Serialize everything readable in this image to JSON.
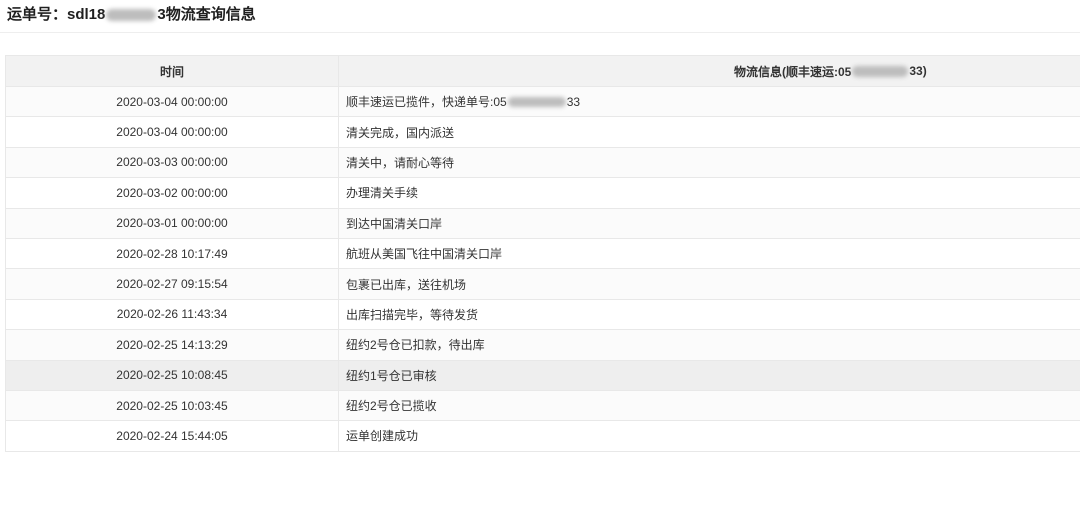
{
  "header": {
    "title_prefix": "运单号：sdl18",
    "title_suffix": "3物流查询信息"
  },
  "table": {
    "columns": {
      "time": "时间",
      "info_prefix": "物流信息(顺丰速运:05",
      "info_suffix": "33)"
    },
    "rows": [
      {
        "time": "2020-03-04 00:00:00",
        "info": "顺丰速运已揽件，快递单号:05",
        "info_suffix": "33"
      },
      {
        "time": "2020-03-04 00:00:00",
        "info": "清关完成，国内派送"
      },
      {
        "time": "2020-03-03 00:00:00",
        "info": "清关中，请耐心等待"
      },
      {
        "time": "2020-03-02 00:00:00",
        "info": "办理清关手续"
      },
      {
        "time": "2020-03-01 00:00:00",
        "info": "到达中国清关口岸"
      },
      {
        "time": "2020-02-28 10:17:49",
        "info": "航班从美国飞往中国清关口岸"
      },
      {
        "time": "2020-02-27 09:15:54",
        "info": "包裹已出库，送往机场"
      },
      {
        "time": "2020-02-26 11:43:34",
        "info": "出库扫描完毕，等待发货"
      },
      {
        "time": "2020-02-25 14:13:29",
        "info": "纽约2号仓已扣款，待出库"
      },
      {
        "time": "2020-02-25 10:08:45",
        "info": "纽约1号仓已审核",
        "hovered": true
      },
      {
        "time": "2020-02-25 10:03:45",
        "info": "纽约2号仓已揽收"
      },
      {
        "time": "2020-02-24 15:44:05",
        "info": "运单创建成功"
      }
    ]
  },
  "colors": {
    "header_bg": "#f2f2f2",
    "hover_row_bg": "#eeeeee",
    "border": "#e8e8e8",
    "text": "#333333"
  }
}
